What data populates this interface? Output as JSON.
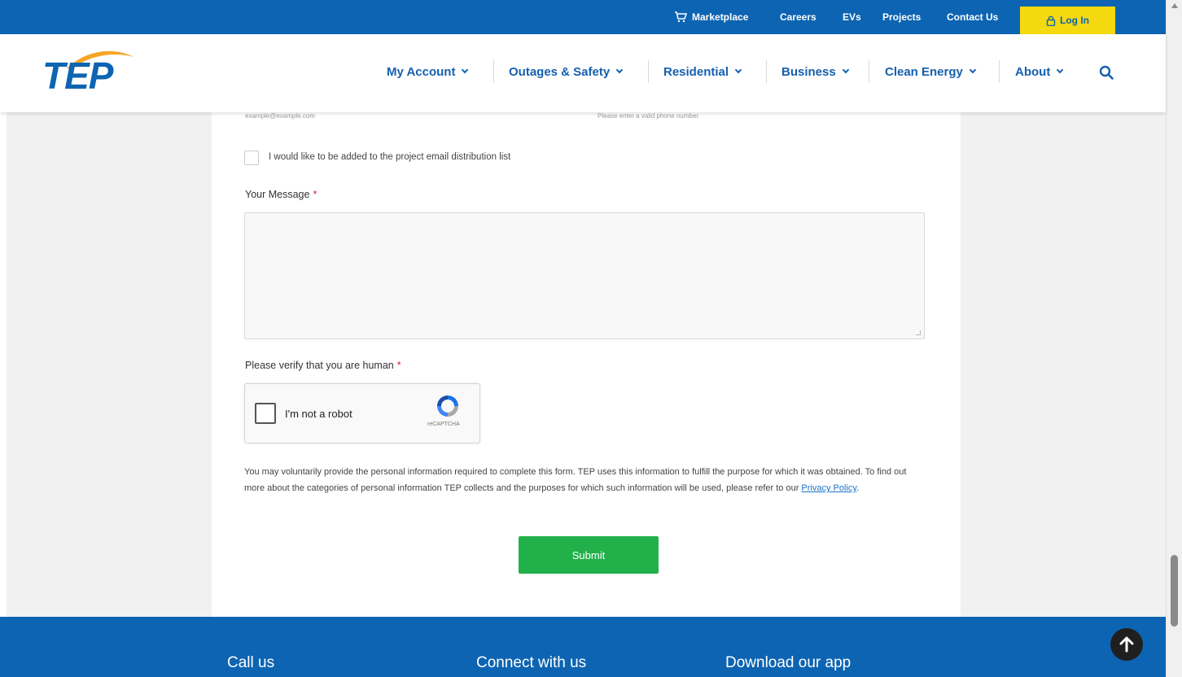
{
  "topbar": {
    "marketplace": "Marketplace",
    "careers": "Careers",
    "evs": "EVs",
    "projects": "Projects",
    "contact": "Contact Us",
    "login": "Log In"
  },
  "header": {
    "logo_text": "TEP",
    "nav": {
      "account": "My Account",
      "outages": "Outages & Safety",
      "residential": "Residential",
      "business": "Business",
      "clean_energy": "Clean Energy",
      "about": "About"
    }
  },
  "form": {
    "email_hint": "example@example.com",
    "phone_hint": "Please enter a valid phone number.",
    "distribution_label": "I would like to be added to the project email distribution list",
    "message_label": "Your Message",
    "verify_label": "Please verify that you are human",
    "required_marker": "*",
    "recaptcha_label": "I'm not a robot",
    "recaptcha_brand": "reCAPTCHA",
    "privacy_text": "You may voluntarily provide the personal information required to complete this form. TEP uses this information to fulfill the purpose for which it was obtained. To find out more about the categories of personal information TEP collects and the purposes for which such information will be used, please refer to our ",
    "privacy_link": "Privacy Policy",
    "privacy_end": ".",
    "submit_label": "Submit"
  },
  "footer": {
    "call": "Call us",
    "connect": "Connect with us",
    "app": "Download our app"
  },
  "colors": {
    "brand_blue": "#0d64b2",
    "login_yellow": "#f5d90f",
    "submit_green": "#22b04b"
  }
}
